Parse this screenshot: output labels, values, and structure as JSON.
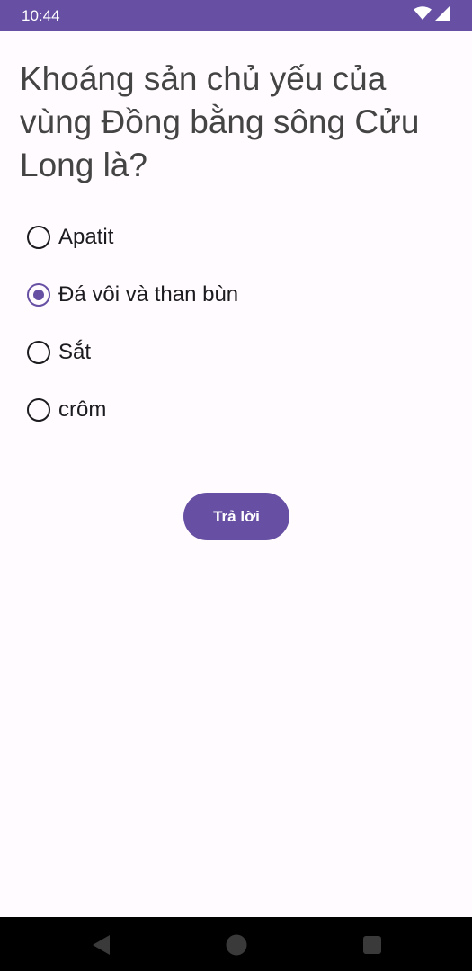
{
  "status_bar": {
    "time": "10:44",
    "icons": [
      "wifi-icon",
      "signal-icon",
      "battery-icon"
    ],
    "background": "#6750a4"
  },
  "question": {
    "text": "Khoáng sản chủ yếu của vùng Đồng bằng sông Cửu Long là?"
  },
  "options": [
    {
      "label": "Apatit",
      "selected": false
    },
    {
      "label": "Đá vôi và than bùn",
      "selected": true
    },
    {
      "label": "Sắt",
      "selected": false
    },
    {
      "label": "crôm",
      "selected": false
    }
  ],
  "answer_button": {
    "label": "Trả lời"
  },
  "nav_bar": {
    "icons": [
      "back-icon",
      "home-icon",
      "recents-icon"
    ]
  },
  "colors": {
    "accent": "#6750a4",
    "background": "#fffbfe",
    "text": "#1c1b1f"
  }
}
